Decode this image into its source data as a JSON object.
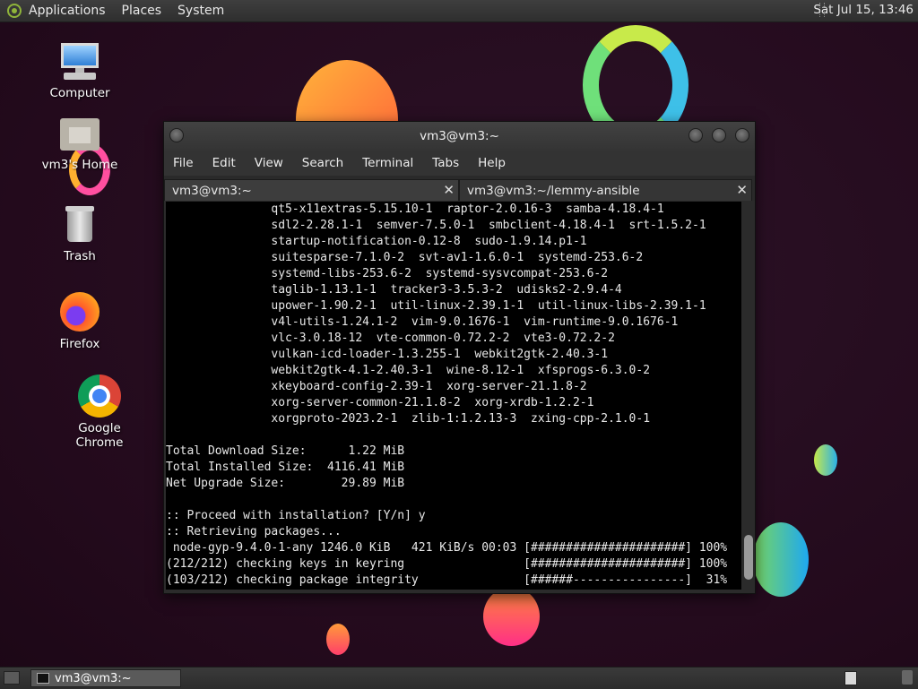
{
  "top_panel": {
    "menus": [
      "Applications",
      "Places",
      "System"
    ],
    "clock": "Sat Jul 15, 13:46"
  },
  "desktop_icons": [
    "Computer",
    "vm3's Home",
    "Trash",
    "Firefox",
    "Google Chrome"
  ],
  "terminal": {
    "title": "vm3@vm3:~",
    "menus": [
      "File",
      "Edit",
      "View",
      "Search",
      "Terminal",
      "Tabs",
      "Help"
    ],
    "tabs": [
      "vm3@vm3:~",
      "vm3@vm3:~/lemmy-ansible"
    ],
    "lines": [
      "               qt5-x11extras-5.15.10-1  raptor-2.0.16-3  samba-4.18.4-1",
      "               sdl2-2.28.1-1  semver-7.5.0-1  smbclient-4.18.4-1  srt-1.5.2-1",
      "               startup-notification-0.12-8  sudo-1.9.14.p1-1",
      "               suitesparse-7.1.0-2  svt-av1-1.6.0-1  systemd-253.6-2",
      "               systemd-libs-253.6-2  systemd-sysvcompat-253.6-2",
      "               taglib-1.13.1-1  tracker3-3.5.3-2  udisks2-2.9.4-4",
      "               upower-1.90.2-1  util-linux-2.39.1-1  util-linux-libs-2.39.1-1",
      "               v4l-utils-1.24.1-2  vim-9.0.1676-1  vim-runtime-9.0.1676-1",
      "               vlc-3.0.18-12  vte-common-0.72.2-2  vte3-0.72.2-2",
      "               vulkan-icd-loader-1.3.255-1  webkit2gtk-2.40.3-1",
      "               webkit2gtk-4.1-2.40.3-1  wine-8.12-1  xfsprogs-6.3.0-2",
      "               xkeyboard-config-2.39-1  xorg-server-21.1.8-2",
      "               xorg-server-common-21.1.8-2  xorg-xrdb-1.2.2-1",
      "               xorgproto-2023.2-1  zlib-1:1.2.13-3  zxing-cpp-2.1.0-1",
      "",
      "Total Download Size:      1.22 MiB",
      "Total Installed Size:  4116.41 MiB",
      "Net Upgrade Size:        29.89 MiB",
      "",
      ":: Proceed with installation? [Y/n] y",
      ":: Retrieving packages...",
      " node-gyp-9.4.0-1-any 1246.0 KiB   421 KiB/s 00:03 [######################] 100%",
      "(212/212) checking keys in keyring                 [######################] 100%",
      "(103/212) checking package integrity               [######----------------]  31%"
    ]
  },
  "taskbar": {
    "window_button": "vm3@vm3:~"
  }
}
